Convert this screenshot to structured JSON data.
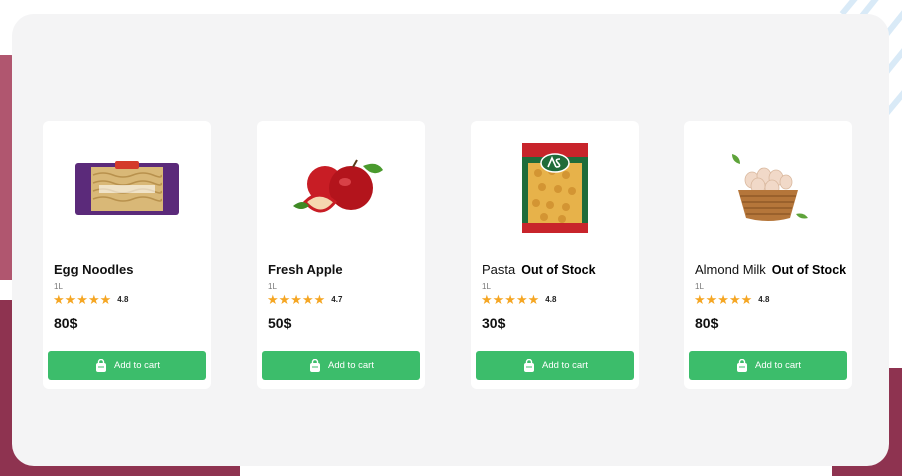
{
  "colors": {
    "accent": "#3cbd6b",
    "star": "#f5a623",
    "panel": "#f4f4f5",
    "bg_shape": "#8e3350"
  },
  "products": [
    {
      "name": "Egg Noodles",
      "stock_status": "",
      "quantity": "1L",
      "stars": "★★★★★",
      "rating": "4.8",
      "price": "80$",
      "cart_label": "Add to cart",
      "image_icon": "egg-noodles-package"
    },
    {
      "name": "Fresh Apple",
      "stock_status": "",
      "quantity": "1L",
      "stars": "★★★★★",
      "rating": "4.7",
      "price": "50$",
      "cart_label": "Add to cart",
      "image_icon": "red-apples"
    },
    {
      "name": "Pasta",
      "stock_status": "Out of Stock",
      "quantity": "1L",
      "stars": "★★★★★",
      "rating": "4.8",
      "price": "30$",
      "cart_label": "Add to cart",
      "image_icon": "pasta-package"
    },
    {
      "name": "Almond Milk",
      "stock_status": "Out of Stock",
      "quantity": "1L",
      "stars": "★★★★★",
      "rating": "4.8",
      "price": "80$",
      "cart_label": "Add to cart",
      "image_icon": "egg-basket"
    }
  ]
}
